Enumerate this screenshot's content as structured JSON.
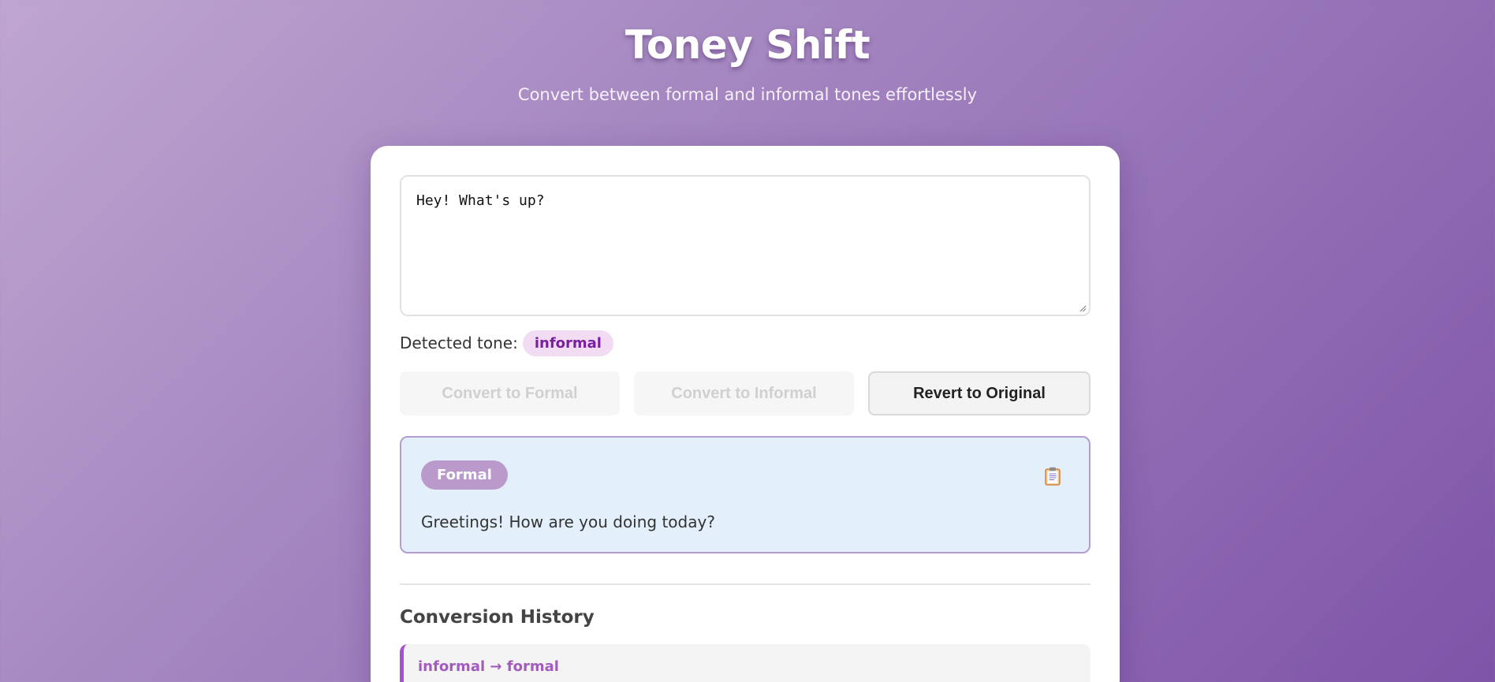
{
  "header": {
    "title": "Toney Shift",
    "subtitle": "Convert between formal and informal tones effortlessly"
  },
  "input": {
    "value": "Hey! What's up?",
    "placeholder": ""
  },
  "detection": {
    "label": "Detected tone:",
    "tone": "informal"
  },
  "actions": {
    "to_formal_label": "Convert to Formal",
    "to_formal_enabled": false,
    "to_informal_label": "Convert to Informal",
    "to_informal_enabled": false,
    "revert_label": "Revert to Original"
  },
  "result": {
    "badge": "Formal",
    "text": "Greetings! How are you doing today?",
    "copy_icon": "clipboard-icon"
  },
  "history": {
    "title": "Conversion History",
    "items": [
      {
        "direction": "informal → formal"
      }
    ]
  },
  "colors": {
    "accent": "#7a1fa0",
    "result_background": "#e3f0fb",
    "result_border": "#b49bd0",
    "history_accent": "#a552cf"
  }
}
